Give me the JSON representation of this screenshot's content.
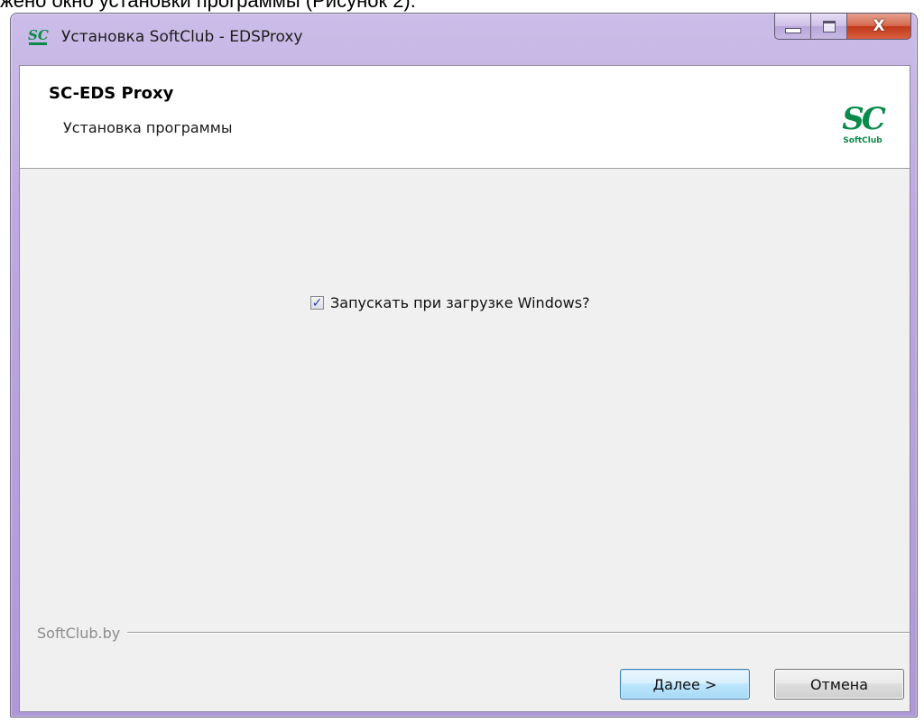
{
  "document": {
    "text_above": "жено окно установки программы (Рисунок 2)."
  },
  "window": {
    "title": "Установка SoftClub - EDSProxy",
    "app_icon": "softclub-logo-icon",
    "controls": {
      "minimize": "minimize-icon",
      "maximize": "maximize-icon",
      "close_glyph": "X"
    }
  },
  "header": {
    "product_name": "SC-EDS Proxy",
    "subtitle": "Установка программы",
    "logo": {
      "letters": "SC",
      "caption": "SoftClub",
      "color": "#0a8a4b"
    }
  },
  "content": {
    "autostart_checkbox": {
      "label": "Запускать при загрузке Windows?",
      "checked": true
    }
  },
  "footer": {
    "brand": "SoftClub.by",
    "next_button": "Далее >",
    "cancel_button": "Отмена"
  },
  "colors": {
    "frame": "#b6a3dd",
    "close_button": "#c2391c",
    "dialog_background": "#f0f0f0",
    "brand_green": "#0a8a4b",
    "default_button_border": "#3c7fb1"
  }
}
